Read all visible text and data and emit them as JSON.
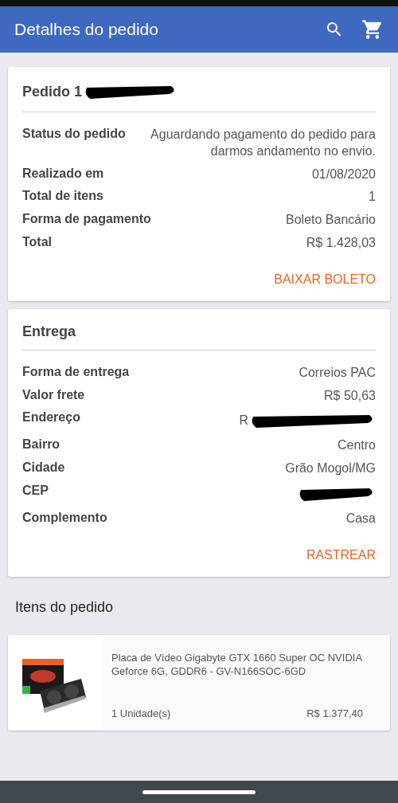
{
  "app_bar": {
    "title": "Detalhes do pedido"
  },
  "order": {
    "title": "Pedido 1",
    "title_redacted": true,
    "rows": [
      {
        "label": "Status do pedido",
        "value": "Aguardando pagamento do pedido para darmos andamento no envio.",
        "redacted": false
      },
      {
        "label": "Realizado em",
        "value": "01/08/2020",
        "redacted": false
      },
      {
        "label": "Total de itens",
        "value": "1",
        "redacted": false
      },
      {
        "label": "Forma de pagamento",
        "value": "Boleto Bancário",
        "redacted": false
      },
      {
        "label": "Total",
        "value": "R$ 1.428,03",
        "redacted": false
      }
    ],
    "action": "BAIXAR BOLETO"
  },
  "delivery": {
    "title": "Entrega",
    "rows": [
      {
        "label": "Forma de entrega",
        "value": "Correios PAC",
        "redacted": false
      },
      {
        "label": "Valor frete",
        "value": "R$ 50,63",
        "redacted": false
      },
      {
        "label": "Endereço",
        "value": "R",
        "redacted": true
      },
      {
        "label": "Bairro",
        "value": "Centro",
        "redacted": false
      },
      {
        "label": "Cidade",
        "value": "Grão Mogol/MG",
        "redacted": false
      },
      {
        "label": "CEP",
        "redacted": true
      },
      {
        "label": "Complemento",
        "value": "Casa",
        "redacted": false
      }
    ],
    "action": "RASTREAR"
  },
  "items_heading": "Itens do pedido",
  "items": [
    {
      "kind": "picture",
      "name": "Placa de Vídeo Gigabyte GTX 1660 Super OC NVIDIA Geforce 6G, GDDR6 - GV-N166SOC-6GD",
      "quantity": "1 Unidade(s)",
      "price": "R$ 1.377,40"
    }
  ]
}
